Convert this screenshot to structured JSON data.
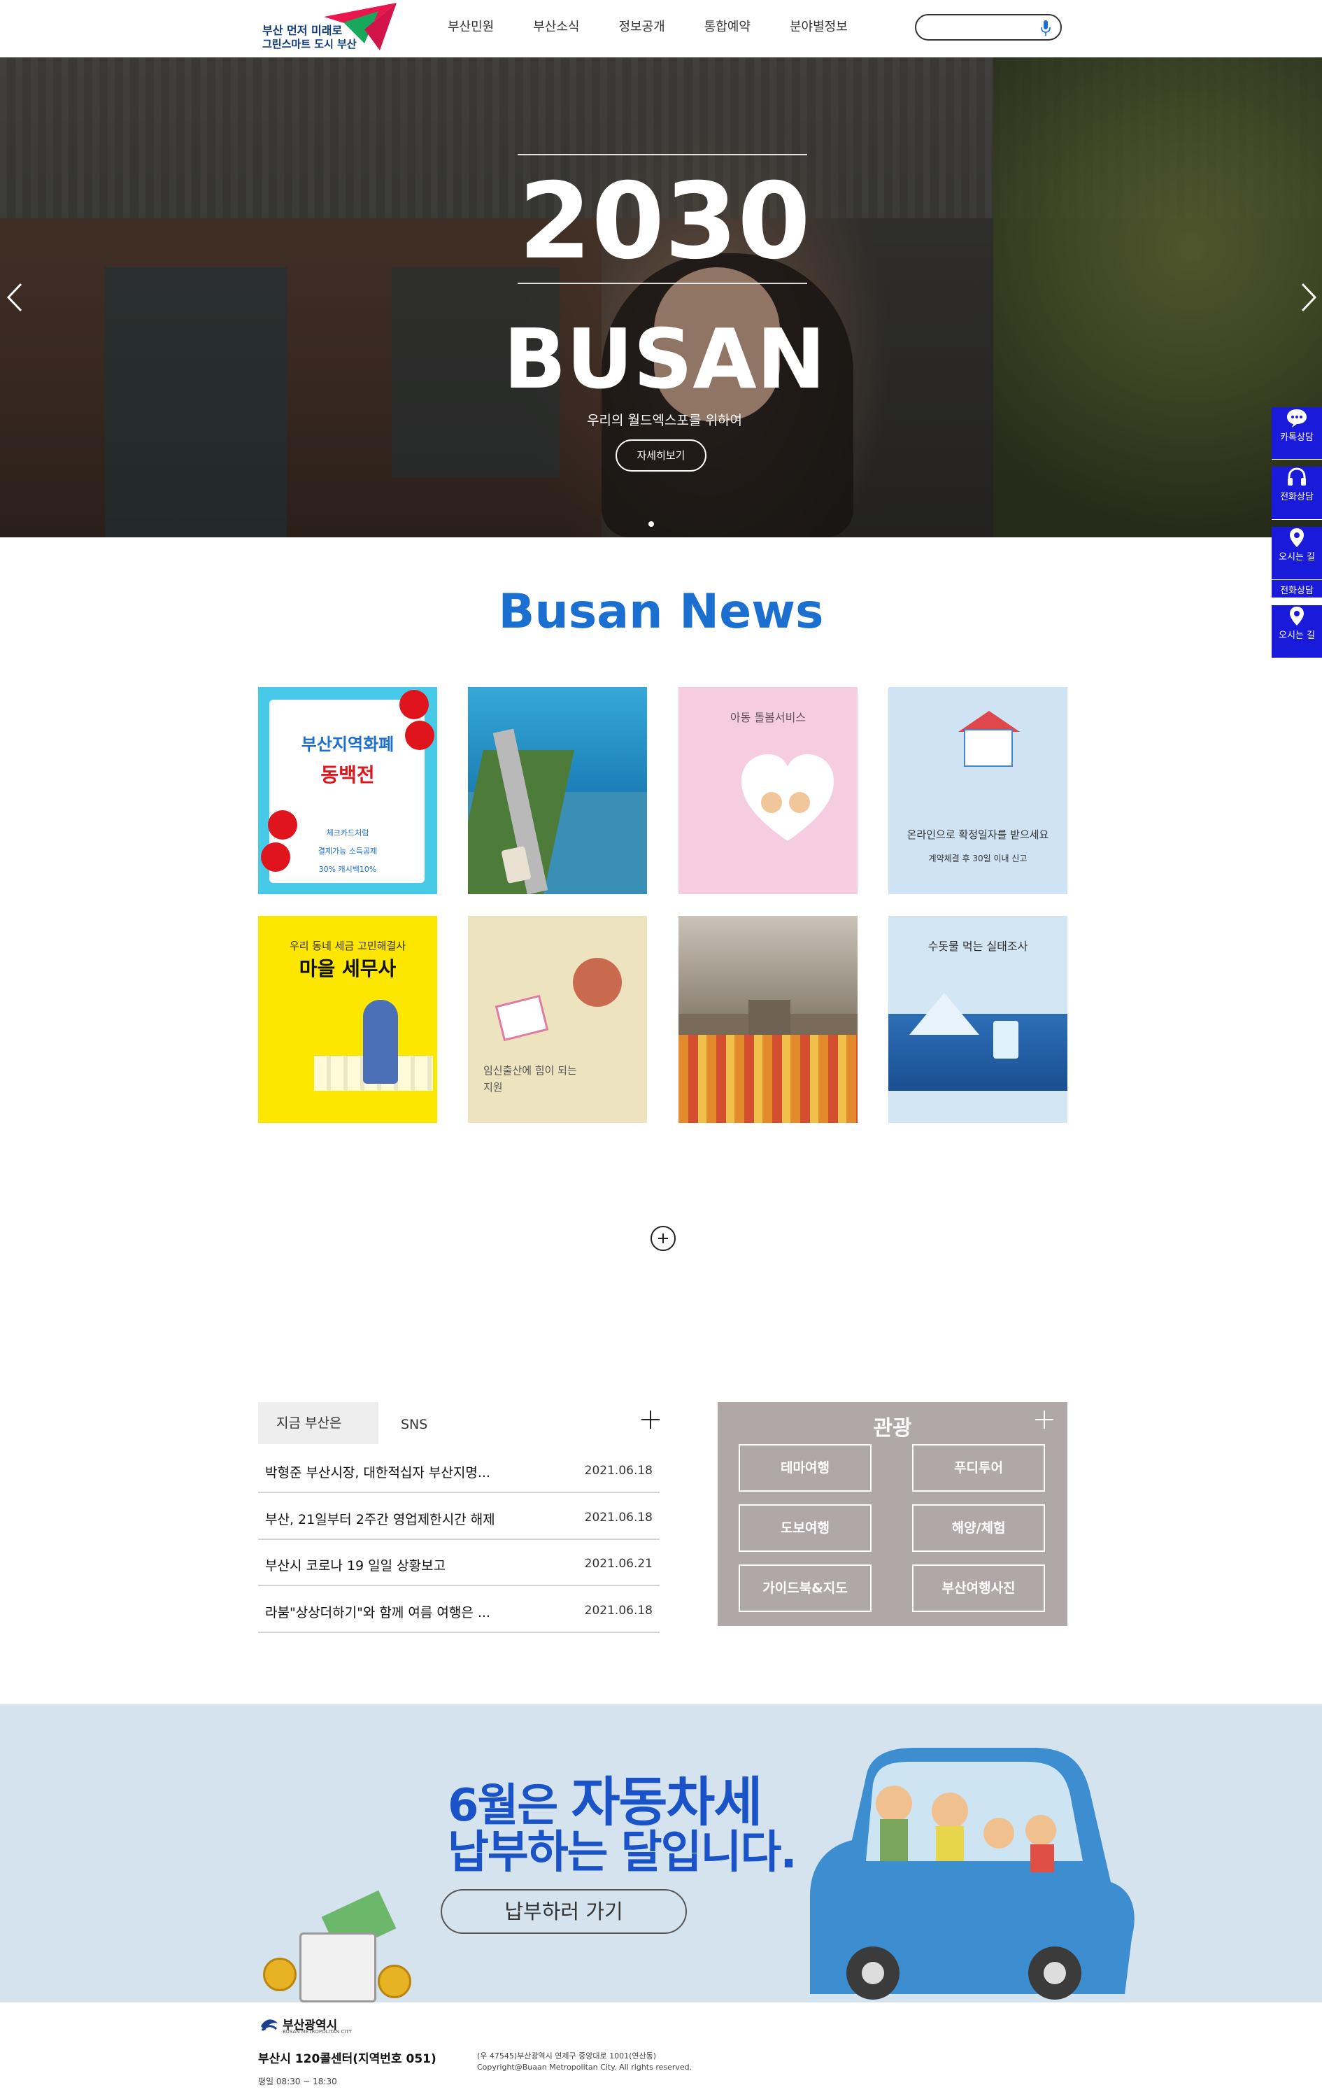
{
  "brand": {
    "logo_line1": "부산 먼저 미래로",
    "logo_line2": "그린스마트 도시 부산",
    "colors": {
      "primary": "#1a1adb",
      "news_title": "#1a6fd0",
      "accent_red": "#e0141c"
    }
  },
  "nav": {
    "items": [
      "부산민원",
      "부산소식",
      "정보공개",
      "통합예약",
      "분야별정보"
    ],
    "search_placeholder": "",
    "mic_icon": "microphone-icon"
  },
  "hero": {
    "year": "2030",
    "city": "BUSAN",
    "subtitle": "우리의 월드엑스포를 위하여",
    "button": "자세히보기",
    "slide_count": 1,
    "active_slide": 1
  },
  "side_menu": [
    {
      "label": "카톡상담",
      "icon": "chat-bubble-icon"
    },
    {
      "label": "전화상담",
      "icon": "headset-icon"
    },
    {
      "label": "오시는 길",
      "icon": "map-pin-icon"
    },
    {
      "label": "전화상담",
      "icon": "none"
    },
    {
      "label": "오시는 길",
      "icon": "map-pin-icon"
    }
  ],
  "news": {
    "title": "Busan News",
    "cards": [
      {
        "lines": [
          "부산지역화폐",
          "동백전",
          "체크카드처럼",
          "결제가능 소득공제",
          "30% 캐시백10%"
        ]
      },
      {
        "lines": []
      },
      {
        "lines": [
          "아동 돌봄서비스"
        ]
      },
      {
        "lines": [
          "온라인으로 확정일자를 받으세요",
          "계약체결 후 30일 이내 신고"
        ]
      },
      {
        "lines": [
          "우리 동네 세금 고민해결사",
          "마을 세무사"
        ]
      },
      {
        "lines": [
          "임신출산에 힘이 되는",
          "지원"
        ]
      },
      {
        "lines": []
      },
      {
        "lines": [
          "수돗물 먹는 실태조사"
        ]
      }
    ],
    "more_icon": "plus-circle-icon"
  },
  "now": {
    "tabs": [
      "지금 부산은",
      "SNS"
    ],
    "items": [
      {
        "title": "박형준 부산시장, 대한적십자 부산지명...",
        "date": "2021.06.18"
      },
      {
        "title": "부산, 21일부터 2주간 영업제한시간 해제",
        "date": "2021.06.18"
      },
      {
        "title": "부산시 코로나 19 일일 상황보고",
        "date": "2021.06.21"
      },
      {
        "title": "라붐\"상상더하기\"와 함께 여름 여행은 ...",
        "date": "2021.06.18"
      }
    ]
  },
  "tour": {
    "title": "관광",
    "buttons": [
      "테마여행",
      "푸디투어",
      "도보여행",
      "해양/체험",
      "가이드북&지도",
      "부산여행사진"
    ]
  },
  "banner": {
    "line1_a": "6월은 ",
    "line1_b": "자동차세",
    "line2": "납부하는 달입니다.",
    "button": "납부하러 가기"
  },
  "footer": {
    "logo_title": "부산광역시",
    "logo_sub": "BUSAN METROPOLITAN CITY",
    "call_center": "부산시 120콜센터(지역번호 051)",
    "hours": "평일 08:30 ~ 18:30",
    "address": "(우 47545)부산광역시 연제구 중앙대로 1001(연산동)",
    "copyright": "Copyright@Buaan Metropolitan City. All rights reserved."
  }
}
